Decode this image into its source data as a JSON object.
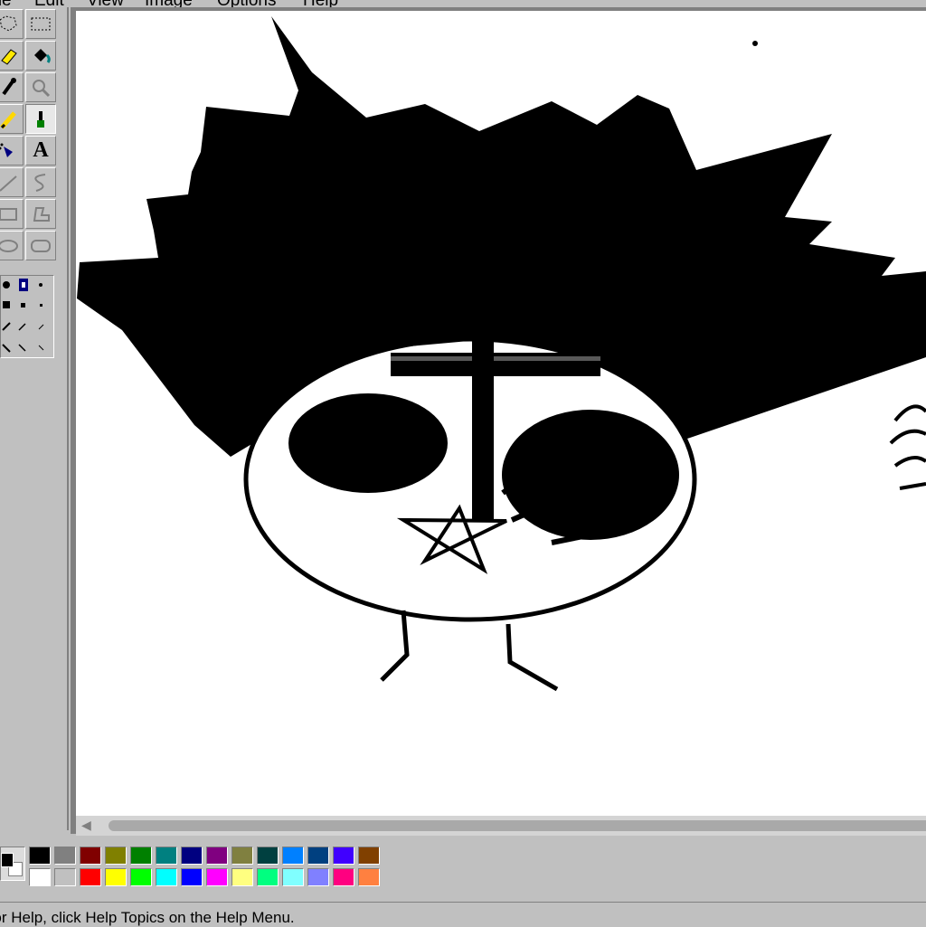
{
  "menu": {
    "items": [
      {
        "label": "File"
      },
      {
        "label": "Edit"
      },
      {
        "label": "View"
      },
      {
        "label": "Image"
      },
      {
        "label": "Options"
      },
      {
        "label": "Help"
      }
    ]
  },
  "toolbox": {
    "tools": [
      {
        "icon": "free-form-select-icon"
      },
      {
        "icon": "rectangle-select-icon"
      },
      {
        "icon": "eraser-icon"
      },
      {
        "icon": "fill-bucket-icon"
      },
      {
        "icon": "color-picker-icon"
      },
      {
        "icon": "magnifier-icon"
      },
      {
        "icon": "pencil-icon"
      },
      {
        "icon": "brush-icon"
      },
      {
        "icon": "airbrush-icon"
      },
      {
        "icon": "text-icon",
        "glyph": "A"
      },
      {
        "icon": "line-icon"
      },
      {
        "icon": "curve-icon"
      },
      {
        "icon": "rectangle-icon"
      },
      {
        "icon": "polygon-icon"
      },
      {
        "icon": "ellipse-icon"
      },
      {
        "icon": "rounded-rectangle-icon"
      }
    ],
    "selected": "brush-icon"
  },
  "palette": {
    "foreground": "#000000",
    "background": "#ffffff",
    "colors_top": [
      "#000000",
      "#808080",
      "#800000",
      "#808000",
      "#008000",
      "#008080",
      "#000080",
      "#800080",
      "#808040",
      "#004040",
      "#0080ff",
      "#004080",
      "#4000ff",
      "#804000"
    ],
    "colors_bottom": [
      "#ffffff",
      "#c0c0c0",
      "#ff0000",
      "#ffff00",
      "#00ff00",
      "#00ffff",
      "#0000ff",
      "#ff00ff",
      "#ffff80",
      "#00ff80",
      "#80ffff",
      "#8080ff",
      "#ff0080",
      "#ff8040"
    ]
  },
  "status": {
    "text": "For Help, click Help Topics on the Help Menu."
  }
}
